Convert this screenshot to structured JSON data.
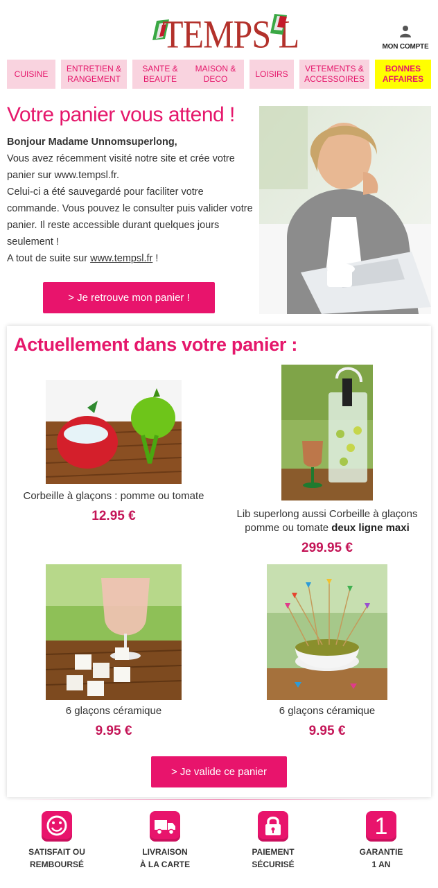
{
  "header": {
    "logo_text": "TEMPS L",
    "account_label": "MON COMPTE"
  },
  "nav": [
    {
      "label": "CUISINE"
    },
    {
      "label": "ENTRETIEN & RANGEMENT"
    },
    {
      "label": "SANTE & BEAUTE"
    },
    {
      "label": "MAISON & DECO"
    },
    {
      "label": "LOISIRS"
    },
    {
      "label": "VETEMENTS & ACCESSOIRES"
    },
    {
      "label": "BONNES AFFAIRES"
    }
  ],
  "intro": {
    "title": "Votre panier vous attend !",
    "greeting": "Bonjour Madame Unnomsuperlong,",
    "line1": "Vous avez récemment visité notre site et crée votre panier sur www.tempsl.fr.",
    "line2": "Celui-ci a été sauvegardé pour faciliter votre commande. Vous pouvez le consulter puis valider votre panier. Il reste accessible durant quelques jours seulement !",
    "line3_prefix": "A tout de suite sur ",
    "line3_link": "www.tempsl.fr",
    "line3_suffix": " !",
    "button": "> Je retrouve mon panier !"
  },
  "cart": {
    "title": "Actuellement dans votre panier :",
    "products": [
      {
        "name": "Corbeille à glaçons : pomme ou tomate",
        "price": "12.95 €"
      },
      {
        "name": "Lib superlong aussi Corbeille à glaçons pomme ou tomate ",
        "name_bold": "deux ligne maxi",
        "price": "299.95 €"
      },
      {
        "name": "6 glaçons céramique",
        "price": "9.95 €"
      },
      {
        "name": "6 glaçons céramique",
        "price": "9.95 €"
      }
    ],
    "button": "> Je valide ce panier"
  },
  "features": [
    {
      "line1": "SATISFAIT OU",
      "line2": "REMBOURSÉ",
      "icon": "smiley-icon"
    },
    {
      "line1": "LIVRAISON",
      "line2": "À LA CARTE",
      "icon": "truck-icon"
    },
    {
      "line1": "PAIEMENT",
      "line2": "SÉCURISÉ",
      "icon": "lock-icon"
    },
    {
      "line1": "GARANTIE",
      "line2": "1 AN",
      "icon": "one-icon",
      "glyph": "1"
    }
  ],
  "colors": {
    "accent": "#e8146c",
    "nav_bg": "#f9d3df",
    "highlight": "#ffff00"
  }
}
